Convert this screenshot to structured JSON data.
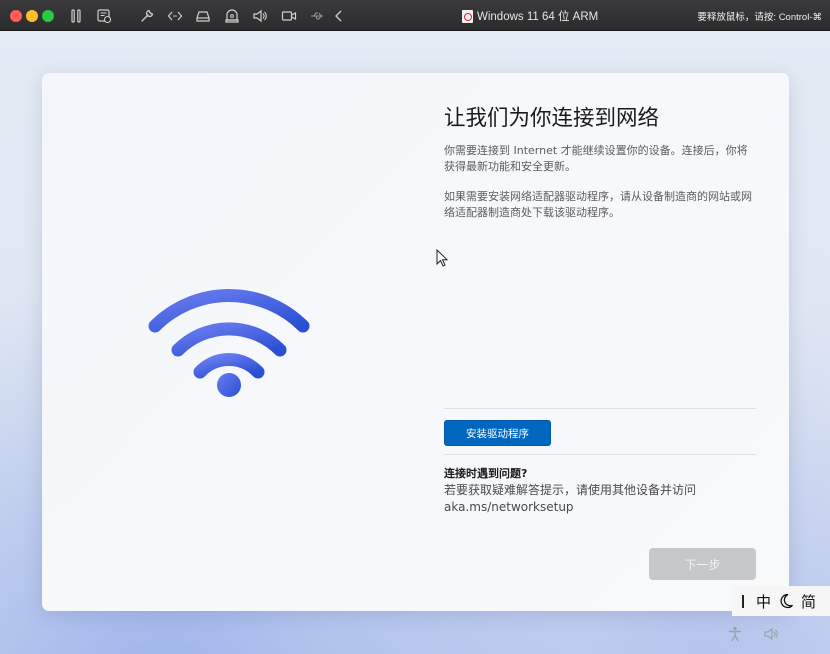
{
  "window": {
    "title": "Windows 11 64 位 ARM",
    "release_hint": "要释放鼠标，请按: Control-⌘"
  },
  "toolbar": {
    "icons": [
      "pause-icon",
      "snapshot-icon",
      "wrench-icon",
      "code-icon",
      "drive-icon",
      "printer-icon",
      "speaker-icon",
      "camera-icon",
      "usb-icon",
      "chevron-left-icon"
    ]
  },
  "oobe": {
    "heading": "让我们为你连接到网络",
    "paragraph1": "你需要连接到 Internet 才能继续设置你的设备。连接后，你将获得最新功能和安全更新。",
    "paragraph2": "如果需要安装网络适配器驱动程序，请从设备制造商的网站或网络适配器制造商处下载该驱动程序。",
    "install_button": "安装驱动程序",
    "trouble_title": "连接时遇到问题?",
    "trouble_text": "若要获取疑难解答提示，请使用其他设备并访问 aka.ms/networksetup",
    "next_button": "下一步",
    "wifi_icon": "wifi-icon",
    "accent_color": "#0067c0",
    "wifi_gradient": [
      "#5b6fe8",
      "#2f54d6"
    ]
  },
  "ime": {
    "mode": "中",
    "script": "简"
  },
  "tray": {
    "icons": [
      "accessibility-icon",
      "volume-icon"
    ]
  }
}
